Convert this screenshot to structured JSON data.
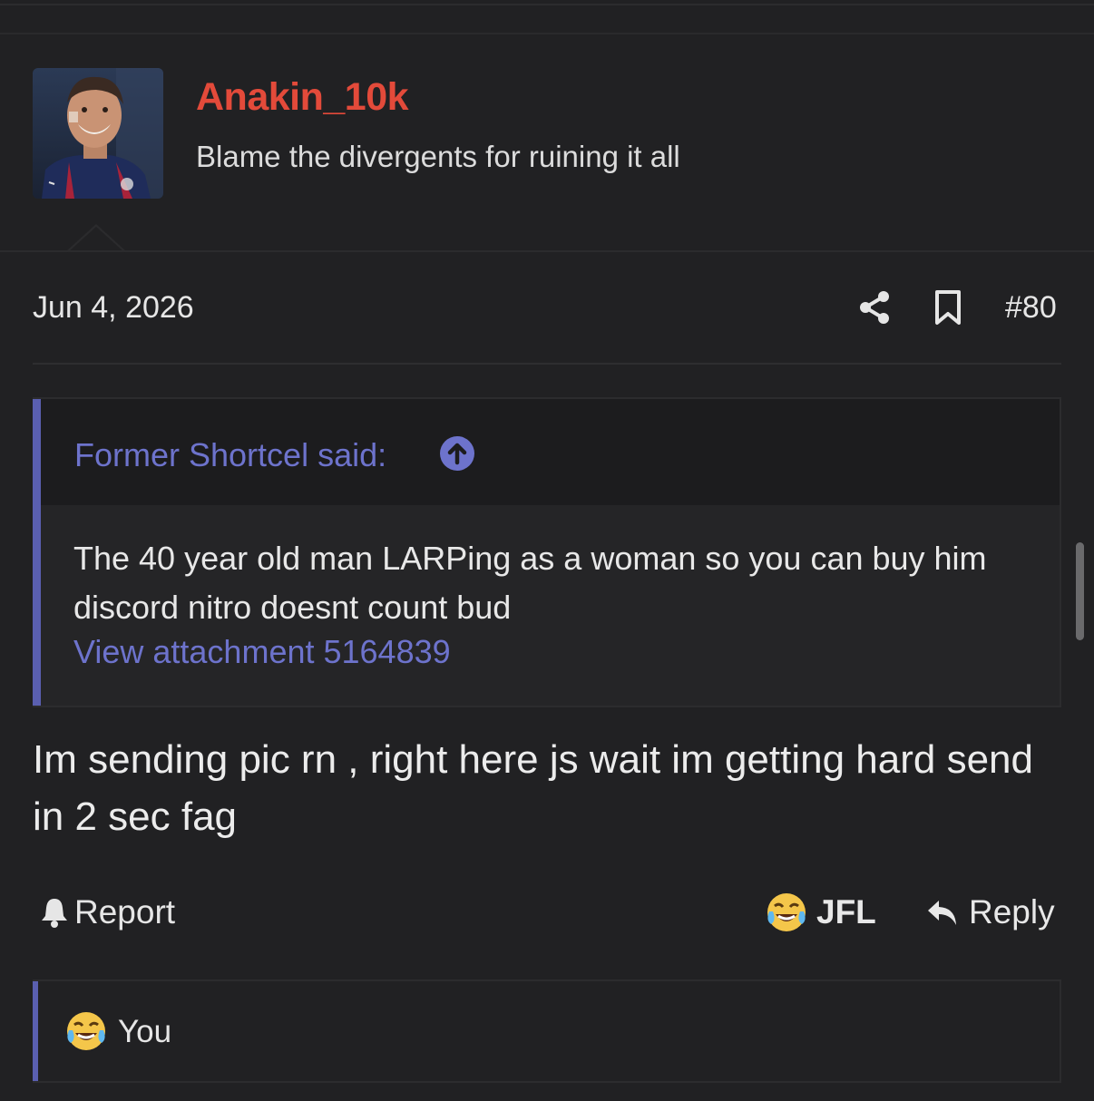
{
  "author": {
    "username": "Anakin_10k",
    "user_title": "Blame the divergents for ruining it all",
    "avatar_icon": "avatar-photo"
  },
  "meta": {
    "date": "Jun 4, 2026",
    "post_number": "#80",
    "share_icon": "share-icon",
    "bookmark_icon": "bookmark-icon"
  },
  "quote": {
    "attribution": "Former Shortcel said:",
    "text": "The 40 year old man LARPing as a woman so you can buy him discord nitro doesnt count bud",
    "attachment_link": "View attachment 5164839"
  },
  "message": {
    "text": "Im sending pic rn , right here js wait im getting hard send in 2 sec fag"
  },
  "actions": {
    "report_label": "Report",
    "reaction_label": "JFL",
    "reply_label": "Reply"
  },
  "reactions_bar": {
    "label": "You",
    "emoji": "crying-laughing-emoji"
  },
  "colors": {
    "background": "#212123",
    "username": "#e34a3a",
    "accent": "#6d73cc",
    "quote_bar": "#5a5fb0"
  }
}
